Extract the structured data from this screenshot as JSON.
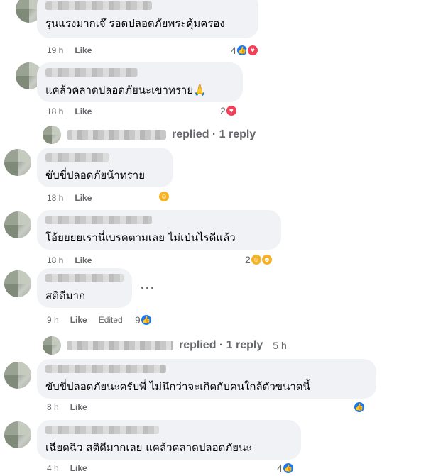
{
  "comments": [
    {
      "text": "รุนแรงมากเจ๊ รอดปลอดภัยพระคุ้มครอง",
      "time": "19 h",
      "like_label": "Like",
      "reaction_count": "4",
      "reactions": [
        "like-icon",
        "love-icon"
      ]
    },
    {
      "text": "แคล้วคลาดปลอดภัยนะเขาทราย🙏",
      "time": "18 h",
      "like_label": "Like",
      "reaction_count": "2",
      "reactions": [
        "love-icon"
      ]
    },
    {
      "text": "ขับขี่ปลอดภัยน้าทราย",
      "time": "18 h",
      "like_label": "Like",
      "reaction_count": "",
      "reactions": [
        "care-icon"
      ]
    },
    {
      "text": "โอ้ยยยยเรานี่เบรคตามเลย ไม่เป่นไรดีแล้ว",
      "time": "18 h",
      "like_label": "Like",
      "reaction_count": "2",
      "reactions": [
        "care-icon",
        "haha-icon"
      ]
    },
    {
      "text": "สติดีมาก",
      "time": "9 h",
      "like_label": "Like",
      "edited_label": "Edited",
      "reaction_count": "9",
      "reactions": [
        "like-icon"
      ]
    },
    {
      "text": "ขับขี่ปลอดภัยนะครับพี่ ไม่นึกว่าจะเกิดกับคนใกล้ตัวขนาดนี้",
      "time": "8 h",
      "like_label": "Like",
      "reaction_count": "",
      "reactions": [
        "like-icon"
      ]
    },
    {
      "text": "เฉียดฉิว สติดีมากเลย แคล้วคลาดปลอดภัยนะ",
      "time": "4 h",
      "like_label": "Like",
      "reaction_count": "4",
      "reactions": [
        "like-icon"
      ]
    }
  ],
  "reply_threads": [
    {
      "label": "replied · 1 reply",
      "time": ""
    },
    {
      "label": "replied · 1 reply",
      "time": "5 h"
    }
  ],
  "colors": {
    "bubble": "#f0f2f5",
    "meta_text": "#65676b",
    "like_blue": "#1877f2",
    "love_red": "#f33e58",
    "care_yellow": "#f7b125"
  }
}
